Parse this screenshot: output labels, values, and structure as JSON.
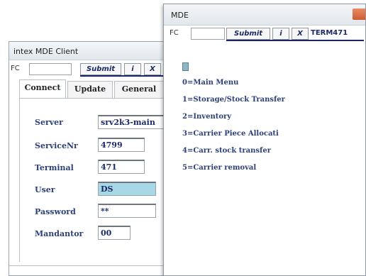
{
  "client_window": {
    "title": "intex MDE Client",
    "toolbar": {
      "label": "FC",
      "submit_label": "Submit",
      "info_label": "i",
      "close_label": "X"
    },
    "tabs": [
      {
        "label": "Connect",
        "active": true
      },
      {
        "label": "Update",
        "active": false
      },
      {
        "label": "General",
        "active": false
      }
    ],
    "fields": [
      {
        "label": "Server",
        "value": "srv2k3-main"
      },
      {
        "label": "ServiceNr",
        "value": "4799"
      },
      {
        "label": "Terminal",
        "value": "471"
      },
      {
        "label": "User",
        "value": "DS",
        "focused": true
      },
      {
        "label": "Password",
        "value": "**"
      },
      {
        "label": "Mandantor",
        "value": "00"
      }
    ]
  },
  "mde_window": {
    "title": "MDE",
    "toolbar": {
      "label": "FC",
      "submit_label": "Submit",
      "info_label": "i",
      "close_label": "X",
      "terminal_label": "TERM471"
    },
    "menu_items": [
      "0=Main Menu",
      "1=Storage/Stock Transfer",
      "2=Inventory",
      "3=Carrier Piece Allocati",
      "4=Carr. stock transfer",
      "5=Carrier removal"
    ]
  },
  "colors": {
    "accent_text": "#2b3f7a",
    "input_focus": "#a7d8e6",
    "button_text": "#1a2a66",
    "close_button": "#d9663a"
  }
}
